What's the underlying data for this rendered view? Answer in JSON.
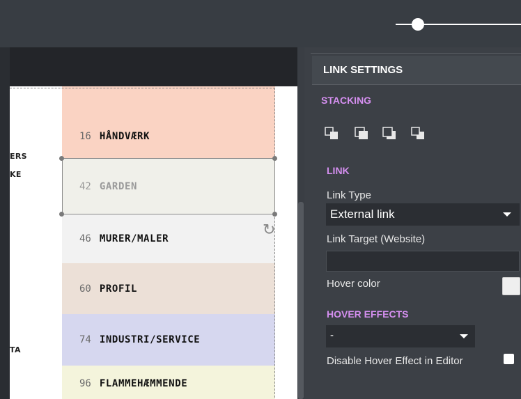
{
  "toolbar": {
    "zoom_slider_value": 0.18
  },
  "canvas": {
    "edge_labels": [
      "ERS",
      "KE",
      "TA"
    ],
    "rows": [
      {
        "number": "16",
        "label": "HÅNDVÆRK",
        "color": "#fad3c3"
      },
      {
        "number": "42",
        "label": "GARDEN",
        "color": "#f0f0ea"
      },
      {
        "number": "46",
        "label": "MURER/MALER",
        "color": "#f2f2f2"
      },
      {
        "number": "60",
        "label": "PROFIL",
        "color": "#ece0d7"
      },
      {
        "number": "74",
        "label": "INDUSTRI/SERVICE",
        "color": "#d6d7ef"
      },
      {
        "number": "96",
        "label": "FLAMMEHÆMMENDE",
        "color": "#f4f4dc"
      }
    ]
  },
  "panel": {
    "title": "LINK SETTINGS",
    "stacking": {
      "title": "STACKING",
      "icons": [
        "bring-to-front-icon",
        "bring-forward-icon",
        "send-backward-icon",
        "send-to-back-icon"
      ]
    },
    "link": {
      "title": "LINK",
      "link_type_label": "Link Type",
      "link_type_value": "External link",
      "link_target_label": "Link Target (Website)",
      "link_target_value": "",
      "hover_color_label": "Hover color",
      "hover_color_value": "#efefef"
    },
    "hover_effects": {
      "title": "HOVER EFFECTS",
      "select_value": "-",
      "disable_in_editor_label": "Disable Hover Effect in Editor",
      "disable_in_editor_checked": false
    },
    "accent_color": "#d58ff0"
  }
}
